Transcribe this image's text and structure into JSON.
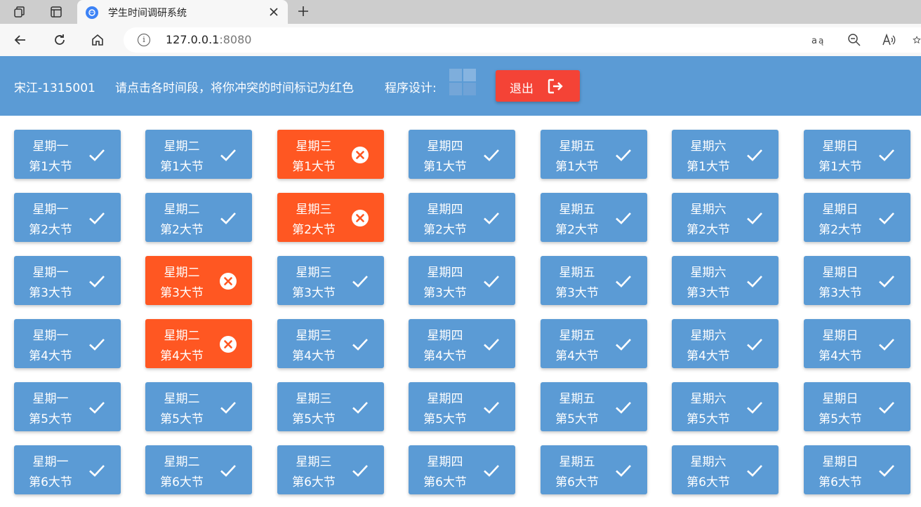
{
  "browser": {
    "tab_title": "学生时间调研系统",
    "url_host": "127.0.0.1",
    "url_port": ":8080"
  },
  "header": {
    "user": "宋江-1315001",
    "instruction": "请点击各时间段，将你冲突的时间标记为红色",
    "design_label": "程序设计:",
    "exit_label": "退出"
  },
  "colors": {
    "available": "#5b9bd5",
    "conflict": "#ff5722",
    "exit": "#f44336"
  },
  "grid": {
    "rows": [
      {
        "period": "第1大节",
        "slots": [
          {
            "day": "星期一",
            "status": "available",
            "icon": "check-icon"
          },
          {
            "day": "星期二",
            "status": "available",
            "icon": "check-icon"
          },
          {
            "day": "星期三",
            "status": "conflict",
            "icon": "cancel-icon"
          },
          {
            "day": "星期四",
            "status": "available",
            "icon": "check-icon"
          },
          {
            "day": "星期五",
            "status": "available",
            "icon": "check-icon"
          },
          {
            "day": "星期六",
            "status": "available",
            "icon": "check-icon"
          },
          {
            "day": "星期日",
            "status": "available",
            "icon": "check-icon"
          }
        ]
      },
      {
        "period": "第2大节",
        "slots": [
          {
            "day": "星期一",
            "status": "available",
            "icon": "check-icon"
          },
          {
            "day": "星期二",
            "status": "available",
            "icon": "check-icon"
          },
          {
            "day": "星期三",
            "status": "conflict",
            "icon": "cancel-icon"
          },
          {
            "day": "星期四",
            "status": "available",
            "icon": "check-icon"
          },
          {
            "day": "星期五",
            "status": "available",
            "icon": "check-icon"
          },
          {
            "day": "星期六",
            "status": "available",
            "icon": "check-icon"
          },
          {
            "day": "星期日",
            "status": "available",
            "icon": "check-icon"
          }
        ]
      },
      {
        "period": "第3大节",
        "slots": [
          {
            "day": "星期一",
            "status": "available",
            "icon": "check-icon"
          },
          {
            "day": "星期二",
            "status": "conflict",
            "icon": "cancel-icon"
          },
          {
            "day": "星期三",
            "status": "available",
            "icon": "check-icon"
          },
          {
            "day": "星期四",
            "status": "available",
            "icon": "check-icon"
          },
          {
            "day": "星期五",
            "status": "available",
            "icon": "check-icon"
          },
          {
            "day": "星期六",
            "status": "available",
            "icon": "check-icon"
          },
          {
            "day": "星期日",
            "status": "available",
            "icon": "check-icon"
          }
        ]
      },
      {
        "period": "第4大节",
        "slots": [
          {
            "day": "星期一",
            "status": "available",
            "icon": "check-icon"
          },
          {
            "day": "星期二",
            "status": "conflict",
            "icon": "cancel-icon"
          },
          {
            "day": "星期三",
            "status": "available",
            "icon": "check-icon"
          },
          {
            "day": "星期四",
            "status": "available",
            "icon": "check-icon"
          },
          {
            "day": "星期五",
            "status": "available",
            "icon": "check-icon"
          },
          {
            "day": "星期六",
            "status": "available",
            "icon": "check-icon"
          },
          {
            "day": "星期日",
            "status": "available",
            "icon": "check-icon"
          }
        ]
      },
      {
        "period": "第5大节",
        "slots": [
          {
            "day": "星期一",
            "status": "available",
            "icon": "check-icon"
          },
          {
            "day": "星期二",
            "status": "available",
            "icon": "check-icon"
          },
          {
            "day": "星期三",
            "status": "available",
            "icon": "check-icon"
          },
          {
            "day": "星期四",
            "status": "available",
            "icon": "check-icon"
          },
          {
            "day": "星期五",
            "status": "available",
            "icon": "check-icon"
          },
          {
            "day": "星期六",
            "status": "available",
            "icon": "check-icon"
          },
          {
            "day": "星期日",
            "status": "available",
            "icon": "check-icon"
          }
        ]
      },
      {
        "period": "第6大节",
        "slots": [
          {
            "day": "星期一",
            "status": "available",
            "icon": "check-icon"
          },
          {
            "day": "星期二",
            "status": "available",
            "icon": "check-icon"
          },
          {
            "day": "星期三",
            "status": "available",
            "icon": "check-icon"
          },
          {
            "day": "星期四",
            "status": "available",
            "icon": "check-icon"
          },
          {
            "day": "星期五",
            "status": "available",
            "icon": "check-icon"
          },
          {
            "day": "星期六",
            "status": "available",
            "icon": "check-icon"
          },
          {
            "day": "星期日",
            "status": "available",
            "icon": "check-icon"
          }
        ]
      }
    ]
  }
}
